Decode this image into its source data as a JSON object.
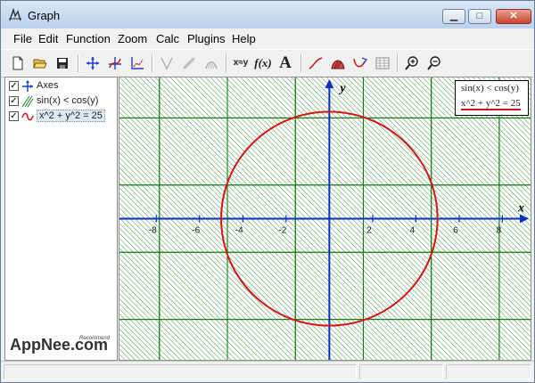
{
  "window": {
    "title": "Graph"
  },
  "menu": [
    "File",
    "Edit",
    "Function",
    "Zoom",
    "Calc",
    "Plugins",
    "Help"
  ],
  "toolbar": {
    "xy_label": "x≈y",
    "fx_label": "f(x)",
    "text_label": "A"
  },
  "function_list": [
    {
      "label": "Axes",
      "checked": true
    },
    {
      "label": "sin(x) < cos(y)",
      "checked": true
    },
    {
      "label": "x^2 + y^2 = 25",
      "checked": true,
      "selected": true
    }
  ],
  "legend": [
    "sin(x) < cos(y)",
    "x^2 + y^2 = 25"
  ],
  "plot": {
    "x_axis_label": "x",
    "y_axis_label": "y",
    "x_ticks": [
      "-8",
      "-6",
      "-4",
      "-2",
      "2",
      "4",
      "6",
      "8"
    ],
    "x_tick_values": [
      -8,
      -6,
      -4,
      -2,
      2,
      4,
      6,
      8
    ],
    "x_range": [
      -9.7,
      9.3
    ],
    "y_range": [
      -6.6,
      6.6
    ],
    "circle_radius": 5,
    "colors": {
      "axes": "#0b2fc2",
      "shading": "#0d7a0d",
      "circle": "#d51515"
    }
  },
  "watermark": {
    "brand": "AppNee.com",
    "tag": "Recommend"
  }
}
